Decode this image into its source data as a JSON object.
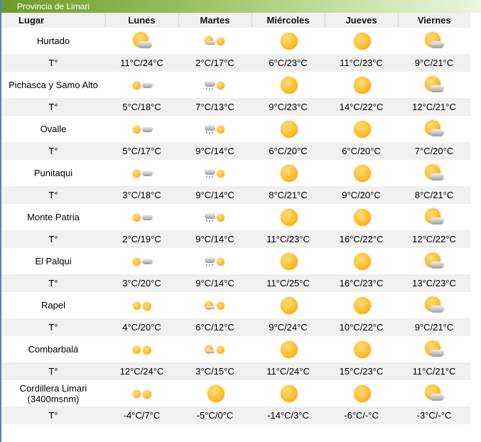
{
  "title": "Provincia de Limari",
  "headers": [
    "Lugar",
    "Lunes",
    "Martes",
    "Miércoles",
    "Jueves",
    "Viernes"
  ],
  "temp_label": "T°",
  "rows": [
    {
      "place": "Hurtado",
      "icons": [
        "sun-cloud-large-icon",
        "sun-small-rain-icon",
        "sun-icon",
        "sun-icon",
        "sun-cloud-large-icon"
      ],
      "temps": [
        "11°C/24°C",
        "2°C/17°C",
        "6°C/23°C",
        "11°C/23°C",
        "9°C/21°C"
      ]
    },
    {
      "place": "Pichasca y Samo Alto",
      "icons": [
        "sun-small-cloud-icon",
        "rain-cloud-sun-icon",
        "sun-icon",
        "sun-icon",
        "sun-cloud-large-icon"
      ],
      "temps": [
        "5°C/18°C",
        "7°C/13°C",
        "9°C/23°C",
        "14°C/22°C",
        "12°C/21°C"
      ]
    },
    {
      "place": "Ovalle",
      "icons": [
        "sun-small-cloud-icon",
        "rain-cloud-sun-icon",
        "sun-icon",
        "sun-icon",
        "sun-cloud-large-icon"
      ],
      "temps": [
        "5°C/17°C",
        "9°C/14°C",
        "6°C/20°C",
        "6°C/20°C",
        "7°C/20°C"
      ]
    },
    {
      "place": "Punitaqui",
      "icons": [
        "sun-small-cloud-icon",
        "rain-cloud-sun-icon",
        "sun-icon",
        "sun-icon",
        "sun-cloud-large-icon"
      ],
      "temps": [
        "3°C/18°C",
        "9°C/14°C",
        "8°C/21°C",
        "9°C/20°C",
        "8°C/21°C"
      ]
    },
    {
      "place": "Monte Patria",
      "icons": [
        "sun-small-cloud-icon",
        "rain-cloud-sun-icon",
        "sun-icon",
        "sun-icon",
        "sun-cloud-large-icon"
      ],
      "temps": [
        "2°C/19°C",
        "9°C/14°C",
        "11°C/23°C",
        "16°C/22°C",
        "12°C/22°C"
      ]
    },
    {
      "place": "El Palqui",
      "icons": [
        "sun-small-cloud-icon",
        "rain-cloud-sun-icon",
        "sun-icon",
        "sun-icon",
        "sun-cloud-large-icon"
      ],
      "temps": [
        "3°C/20°C",
        "9°C/14°C",
        "11°C/25°C",
        "16°C/23°C",
        "13°C/23°C"
      ]
    },
    {
      "place": "Rapel",
      "icons": [
        "sun-sun-icon",
        "sun-small-sun-icon",
        "sun-icon",
        "sun-icon",
        "sun-cloud-large-icon"
      ],
      "temps": [
        "4°C/20°C",
        "6°C/12°C",
        "9°C/24°C",
        "10°C/22°C",
        "9°C/21°C"
      ]
    },
    {
      "place": "Combarbalá",
      "icons": [
        "sun-sun-icon",
        "sun-small-sun-icon",
        "sun-icon",
        "sun-icon",
        "sun-cloud-large-icon"
      ],
      "temps": [
        "12°C/24°C",
        "3°C/15°C",
        "11°C/24°C",
        "15°C/23°C",
        "11°C/21°C"
      ]
    },
    {
      "place": "Cordillera Limari (3400msnm)",
      "icons": [
        "sun-sun-icon",
        "sun-icon",
        "sun-icon",
        "sun-icon",
        "sun-cloud-large-icon"
      ],
      "temps": [
        "-4°C/7°C",
        "-5°C/0°C",
        "-14°C/3°C",
        "-6°C/-°C",
        "-3°C/-°C"
      ]
    }
  ]
}
